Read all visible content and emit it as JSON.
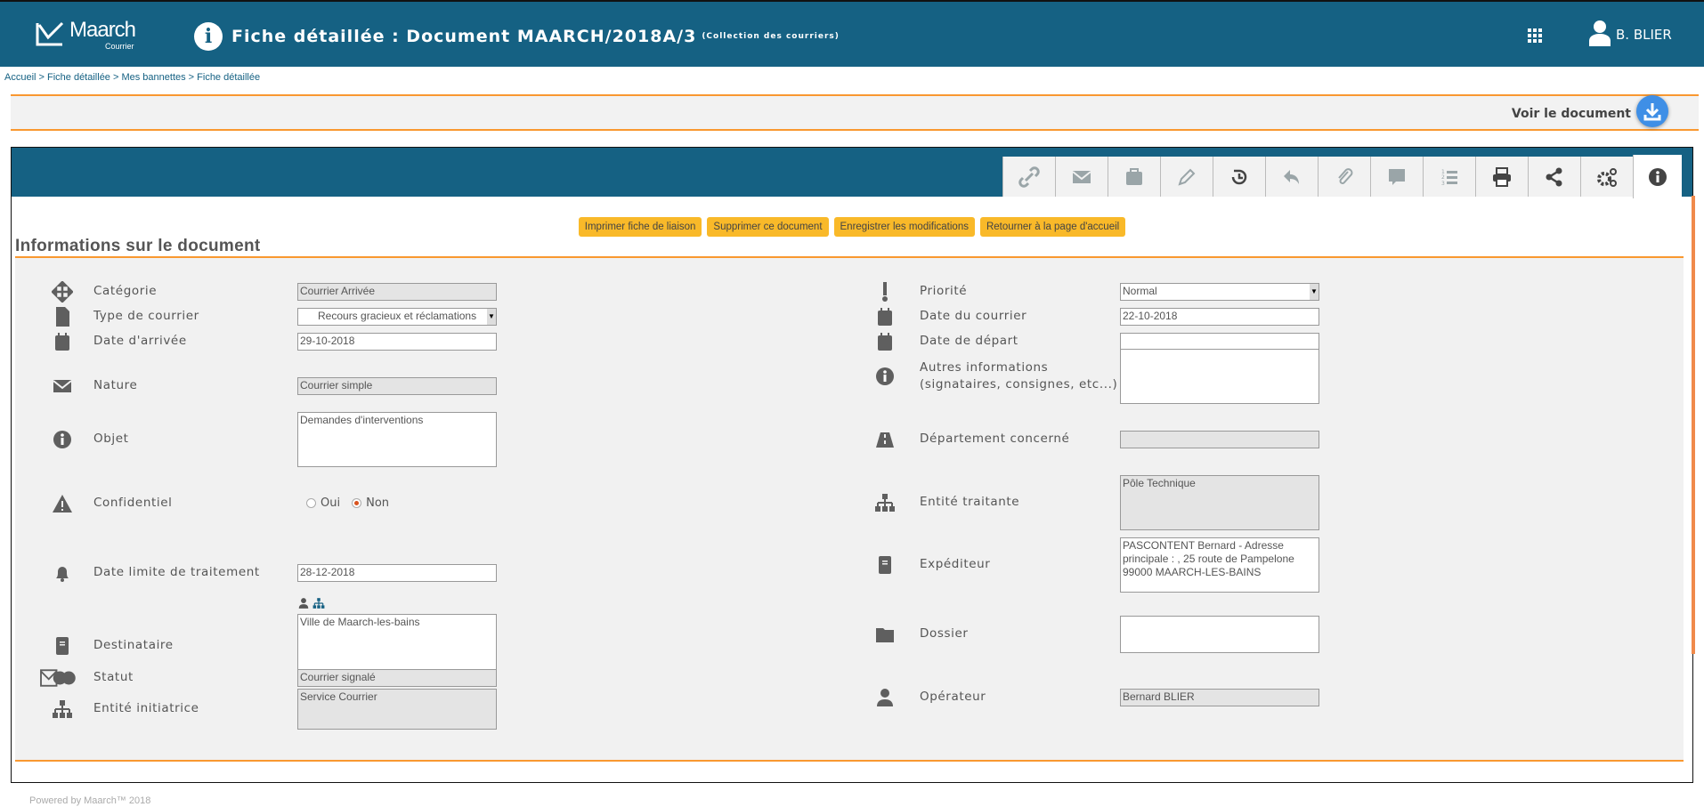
{
  "header": {
    "logo_name": "Maarch",
    "logo_sub": "Courrier",
    "title": "Fiche détaillée : Document MAARCH/2018A/3",
    "collection": "(Collection des courriers)",
    "user": "B. BLIER",
    "accent": "#156183"
  },
  "breadcrumb": "Accueil > Fiche détaillée > Mes bannettes > Fiche détaillée",
  "toolbar": {
    "view_document": "Voir le document"
  },
  "tabs": [
    "link-icon",
    "envelope-icon",
    "briefcase-icon",
    "pencil-icon",
    "history-icon",
    "reply-icon",
    "paperclip-icon",
    "comment-icon",
    "numbered-list-icon",
    "print-icon",
    "share-icon",
    "gears-icon",
    "info-icon"
  ],
  "actions": [
    "Imprimer fiche de liaison",
    "Supprimer ce document",
    "Enregistrer les modifications",
    "Retourner à la page d'accueil"
  ],
  "section_title": "Informations sur le document",
  "left_fields": [
    {
      "icon": "arrows-icon",
      "label": "Catégorie",
      "value": "Courrier Arrivée",
      "kind": "readonly"
    },
    {
      "icon": "file-icon",
      "label": "Type de courrier",
      "value": "Recours gracieux et réclamations",
      "kind": "select"
    },
    {
      "icon": "calendar-icon",
      "label": "Date d'arrivée",
      "value": "29-10-2018",
      "kind": "input"
    },
    {
      "icon": "envelope-icon",
      "label": "Nature",
      "value": "Courrier simple",
      "kind": "readonly"
    },
    {
      "icon": "info-icon",
      "label": "Objet",
      "value": "Demandes d'interventions",
      "kind": "textarea"
    },
    {
      "icon": "warning-icon",
      "label": "Confidentiel",
      "options": [
        "Oui",
        "Non"
      ],
      "selected": "Non",
      "kind": "radio"
    },
    {
      "icon": "bell-icon",
      "label": "Date limite de traitement",
      "value": "28-12-2018",
      "kind": "input"
    },
    {
      "icon": "address-book-icon",
      "label": "Destinataire",
      "value": "Ville de Maarch-les-bains",
      "kind": "textarea"
    },
    {
      "icon": "status-icon",
      "label": "Statut",
      "value": "Courrier signalé",
      "kind": "readonly"
    },
    {
      "icon": "sitemap-icon",
      "label": "Entité initiatrice",
      "value": "Service Courrier",
      "kind": "readonly-textarea"
    }
  ],
  "right_fields": [
    {
      "icon": "exclamation-icon",
      "label": "Priorité",
      "value": "Normal",
      "kind": "select"
    },
    {
      "icon": "calendar-icon",
      "label": "Date du courrier",
      "value": "22-10-2018",
      "kind": "input"
    },
    {
      "icon": "calendar-icon",
      "label": "Date de départ",
      "value": "",
      "kind": "input"
    },
    {
      "icon": "info-circle-icon",
      "label": "Autres informations (signataires, consignes, etc...)",
      "value": "",
      "kind": "textarea"
    },
    {
      "icon": "road-icon",
      "label": "Département concerné",
      "value": "",
      "kind": "readonly"
    },
    {
      "icon": "sitemap-icon",
      "label": "Entité traitante",
      "value": "Pôle Technique",
      "kind": "readonly-textarea"
    },
    {
      "icon": "address-book-icon",
      "label": "Expéditeur",
      "value": "PASCONTENT Bernard - Adresse principale : , 25 route de Pampelone 99000 MAARCH-LES-BAINS",
      "kind": "textarea"
    },
    {
      "icon": "folder-icon",
      "label": "Dossier",
      "value": "",
      "kind": "input"
    },
    {
      "icon": "user-icon",
      "label": "Opérateur",
      "value": "Bernard BLIER",
      "kind": "readonly"
    }
  ],
  "footer": "Powered by Maarch™ 2018"
}
